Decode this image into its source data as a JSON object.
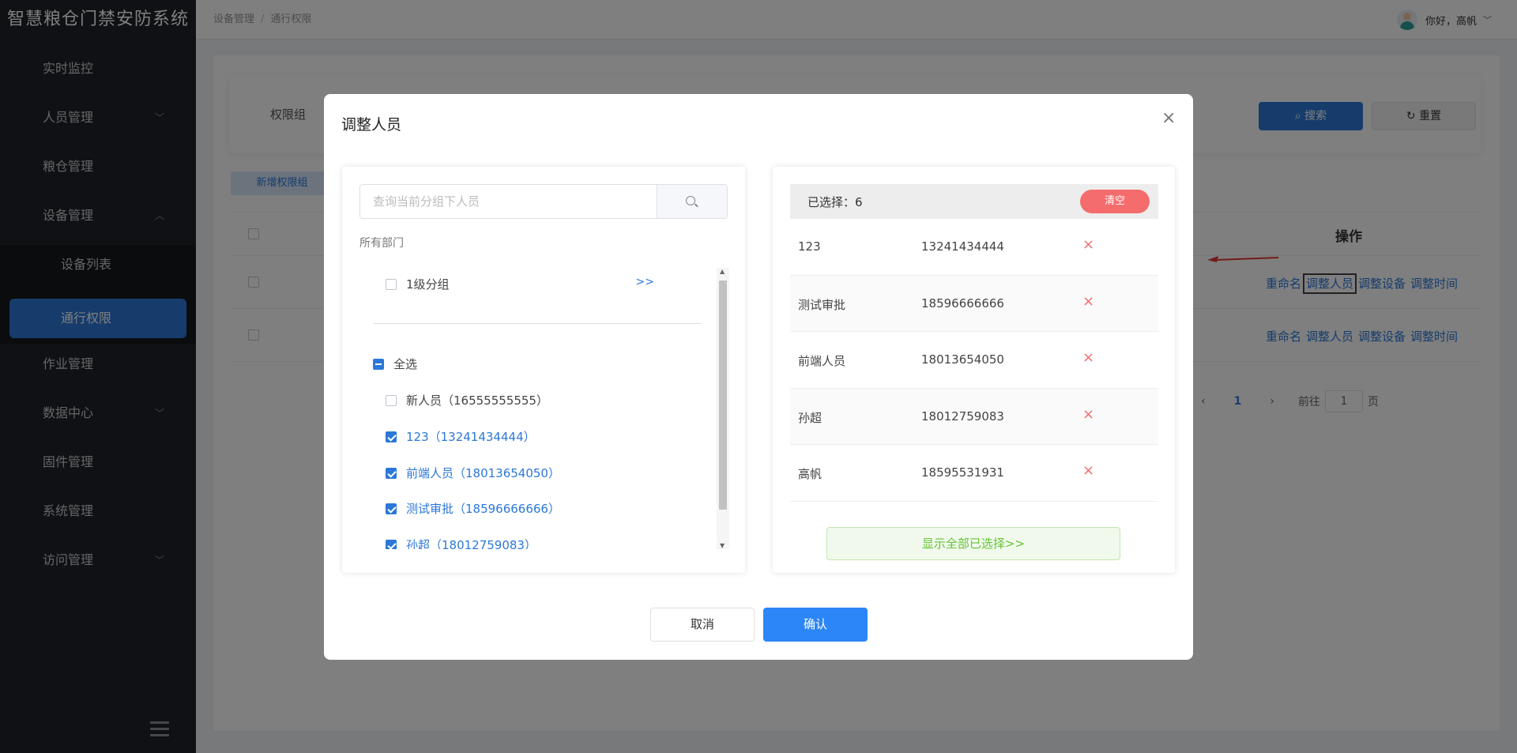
{
  "app": {
    "title": "智慧粮仓门禁安防系统"
  },
  "sidebar": {
    "items": [
      {
        "label": "实时监控"
      },
      {
        "label": "人员管理"
      },
      {
        "label": "粮仓管理"
      },
      {
        "label": "设备管理"
      },
      {
        "label": "设备列表"
      },
      {
        "label": "通行权限"
      },
      {
        "label": "作业管理"
      },
      {
        "label": "数据中心"
      },
      {
        "label": "固件管理"
      },
      {
        "label": "系统管理"
      },
      {
        "label": "访问管理"
      }
    ]
  },
  "breadcrumb": {
    "first": "设备管理",
    "sep": "/",
    "second": "通行权限"
  },
  "user": {
    "greeting": "你好，高帆"
  },
  "page": {
    "search_label": "权限组",
    "search_button": "搜索",
    "reset_button": "重置",
    "add_button": "新增权限组",
    "ops_header": "操作",
    "row_ops": [
      "重命名",
      "调整人员",
      "调整设备",
      "调整时间"
    ],
    "pager": {
      "current": "1",
      "goto_prefix": "前往",
      "goto_value": "1",
      "goto_suffix": "页"
    }
  },
  "dialog": {
    "title": "调整人员",
    "left": {
      "search_placeholder": "查询当前分组下人员",
      "dept_label": "所有部门",
      "group": {
        "label": "1级分组",
        "more": ">>"
      },
      "select_all": "全选",
      "people": [
        {
          "label": "新人员（16555555555）",
          "checked": false
        },
        {
          "label": "123（13241434444）",
          "checked": true
        },
        {
          "label": "前端人员（18013654050）",
          "checked": true
        },
        {
          "label": "测试审批（18596666666）",
          "checked": true
        },
        {
          "label": "孙超（18012759083）",
          "checked": true
        }
      ]
    },
    "right": {
      "selected_count": "已选择：6",
      "clear_button": "清空",
      "rows": [
        {
          "name": "123",
          "phone": "13241434444",
          "del": "×"
        },
        {
          "name": "测试审批",
          "phone": "18596666666",
          "del": "×"
        },
        {
          "name": "前端人员",
          "phone": "18013654050",
          "del": "×"
        },
        {
          "name": "孙超",
          "phone": "18012759083",
          "del": "×"
        },
        {
          "name": "高帆",
          "phone": "18595531931",
          "del": "×"
        }
      ],
      "show_all": "显示全部已选择>>"
    },
    "cancel_button": "取消",
    "confirm_button": "确认"
  },
  "colors": {
    "primary": "#2c78d8",
    "danger": "#f56c6c",
    "success": "#67c23a",
    "sidebar_bg": "#1f2228"
  }
}
